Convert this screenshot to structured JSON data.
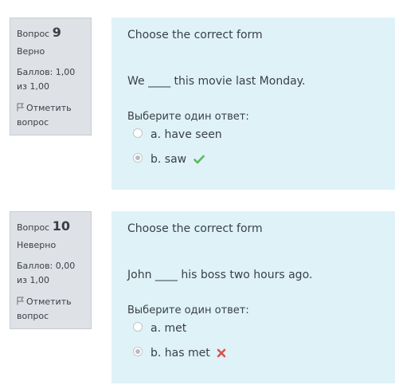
{
  "questions": [
    {
      "label": "Вопрос",
      "number": "9",
      "state": "Верно",
      "grade": "Баллов: 1,00 из 1,00",
      "flag_label": "Отметить вопрос",
      "title": "Choose the correct form",
      "sentence": "We ____ this movie last Monday.",
      "prompt": "Выберите один ответ:",
      "options": [
        {
          "text": "a. have seen",
          "selected": false
        },
        {
          "text": "b. saw",
          "selected": true,
          "feedback_icon": "check-icon",
          "feedback_color": "#5cb85c"
        }
      ]
    },
    {
      "label": "Вопрос",
      "number": "10",
      "state": "Неверно",
      "grade": "Баллов: 0,00 из 1,00",
      "flag_label": "Отметить вопрос",
      "title": "Choose the correct form",
      "sentence": "John ____ his boss two hours ago.",
      "prompt": "Выберите один ответ:",
      "options": [
        {
          "text": "a. met",
          "selected": false
        },
        {
          "text": "b. has met",
          "selected": true,
          "feedback_icon": "cross-icon",
          "feedback_color": "#d9534f"
        }
      ]
    }
  ]
}
